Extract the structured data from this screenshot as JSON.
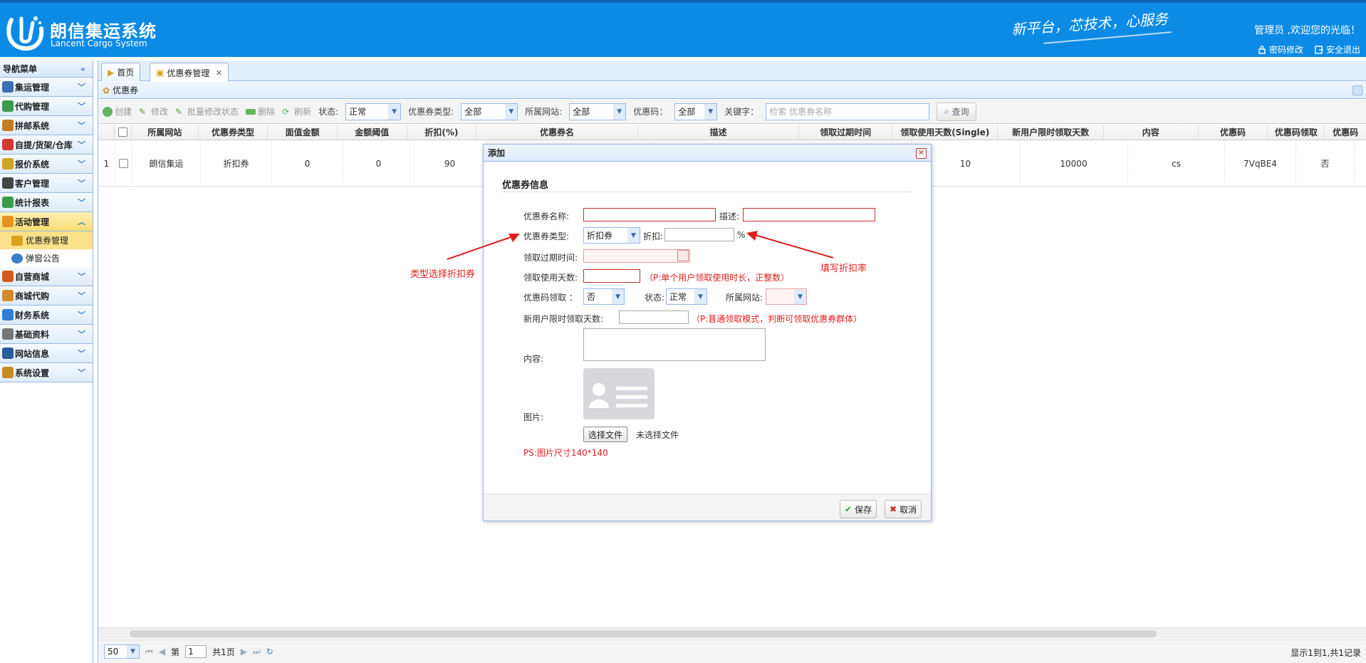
{
  "header": {
    "app_name": "朗信集运系统",
    "app_sub": "Lancent Cargo System",
    "slogan": "新平台，芯技术，心服务",
    "welcome": "管理员 ,欢迎您的光临！",
    "change_password": "密码修改",
    "logout": "安全退出",
    "bg_color": "#0b8be6"
  },
  "sidebar": {
    "title": "导航菜单",
    "items": [
      {
        "label": "集运管理",
        "icon": "monitor-icon",
        "color": "#3d6fb6"
      },
      {
        "label": "代购管理",
        "icon": "globe-icon",
        "color": "#3a9d4a"
      },
      {
        "label": "拼邮系统",
        "icon": "box-icon",
        "color": "#c77b1f"
      },
      {
        "label": "自提/货架/仓库",
        "icon": "ball-icon",
        "color": "#d6362c"
      },
      {
        "label": "报价系统",
        "icon": "chart-icon",
        "color": "#d1a329"
      },
      {
        "label": "客户管理",
        "icon": "user-icon",
        "color": "#444"
      },
      {
        "label": "统计报表",
        "icon": "globe-icon",
        "color": "#3a9d4a"
      },
      {
        "label": "活动管理",
        "icon": "rainbow-icon",
        "color": "#e6931e"
      },
      {
        "label": "自营商城",
        "icon": "basketball-icon",
        "color": "#d35b1b"
      },
      {
        "label": "商城代购",
        "icon": "mail-icon",
        "color": "#d58a2a"
      },
      {
        "label": "财务系统",
        "icon": "chrome-icon",
        "color": "#2f7ed8"
      },
      {
        "label": "基础资料",
        "icon": "stack-icon",
        "color": "#777"
      },
      {
        "label": "网站信息",
        "icon": "font-icon",
        "color": "#2a5d9e"
      },
      {
        "label": "系统设置",
        "icon": "wand-icon",
        "color": "#c98a26"
      }
    ],
    "sub_items": [
      {
        "label": "优惠券管理"
      },
      {
        "label": "弹窗公告"
      }
    ]
  },
  "tabs": [
    {
      "label": "首页"
    },
    {
      "label": "优惠券管理"
    }
  ],
  "panel": {
    "title": "优惠券"
  },
  "toolbar": {
    "create": "创建",
    "edit": "修改",
    "batch_edit_status": "批量修改状态",
    "delete": "删除",
    "refresh": "刷新",
    "status_label": "状态:",
    "status_value": "正常",
    "type_label": "优惠券类型:",
    "type_value": "全部",
    "site_label": "所属网站:",
    "site_value": "全部",
    "code_label": "优惠码：",
    "code_value": "全部",
    "keyword_label": "关键字：",
    "keyword_placeholder": "检索 优惠券名称",
    "search": "查询"
  },
  "grid": {
    "columns": [
      "所属网站",
      "优惠券类型",
      "面值金额",
      "金额阈值",
      "折扣(%)",
      "优惠券名",
      "描述",
      "领取过期时间",
      "领取使用天数(Single)",
      "新用户限时领取天数",
      "内容",
      "优惠码",
      "优惠码领取",
      "优惠码"
    ],
    "rows": [
      [
        "1",
        "朗信集运",
        "折扣券",
        "0",
        "0",
        "90",
        "",
        "",
        "",
        "10",
        "10000",
        "cs",
        "7VqBE4",
        "否"
      ]
    ]
  },
  "pager": {
    "page_size": "50",
    "page_prefix": "第",
    "page_value": "1",
    "page_total": "共1页",
    "info": "显示1到1,共1记录"
  },
  "modal": {
    "title": "添加",
    "section": "优惠券信息",
    "name_label": "优惠券名称:",
    "desc_label": "描述:",
    "type_label": "优惠券类型:",
    "type_value": "折扣券",
    "discount_label": "折扣:",
    "percent": "%",
    "expire_label": "领取过期时间:",
    "use_days_label": "领取使用天数:",
    "use_days_hint": "（P:单个用户领取使用时长，正整数）",
    "code_label": "优惠码领取 ：",
    "code_value": "否",
    "status_label": "状态:",
    "status_value": "正常",
    "site_label": "所属网站:",
    "new_user_label": "新用户限时领取天数:",
    "new_user_hint": "（P:普通领取模式，判断可领取优惠券群体）",
    "content_label": "内容:",
    "image_label": "图片:",
    "file_button": "选择文件",
    "file_status": "未选择文件",
    "image_hint": "PS:图片尺寸140*140",
    "save": "保存",
    "cancel": "取消"
  },
  "annotations": {
    "left": "类型选择折扣券",
    "right": "填写折扣率",
    "color": "#e02020"
  }
}
